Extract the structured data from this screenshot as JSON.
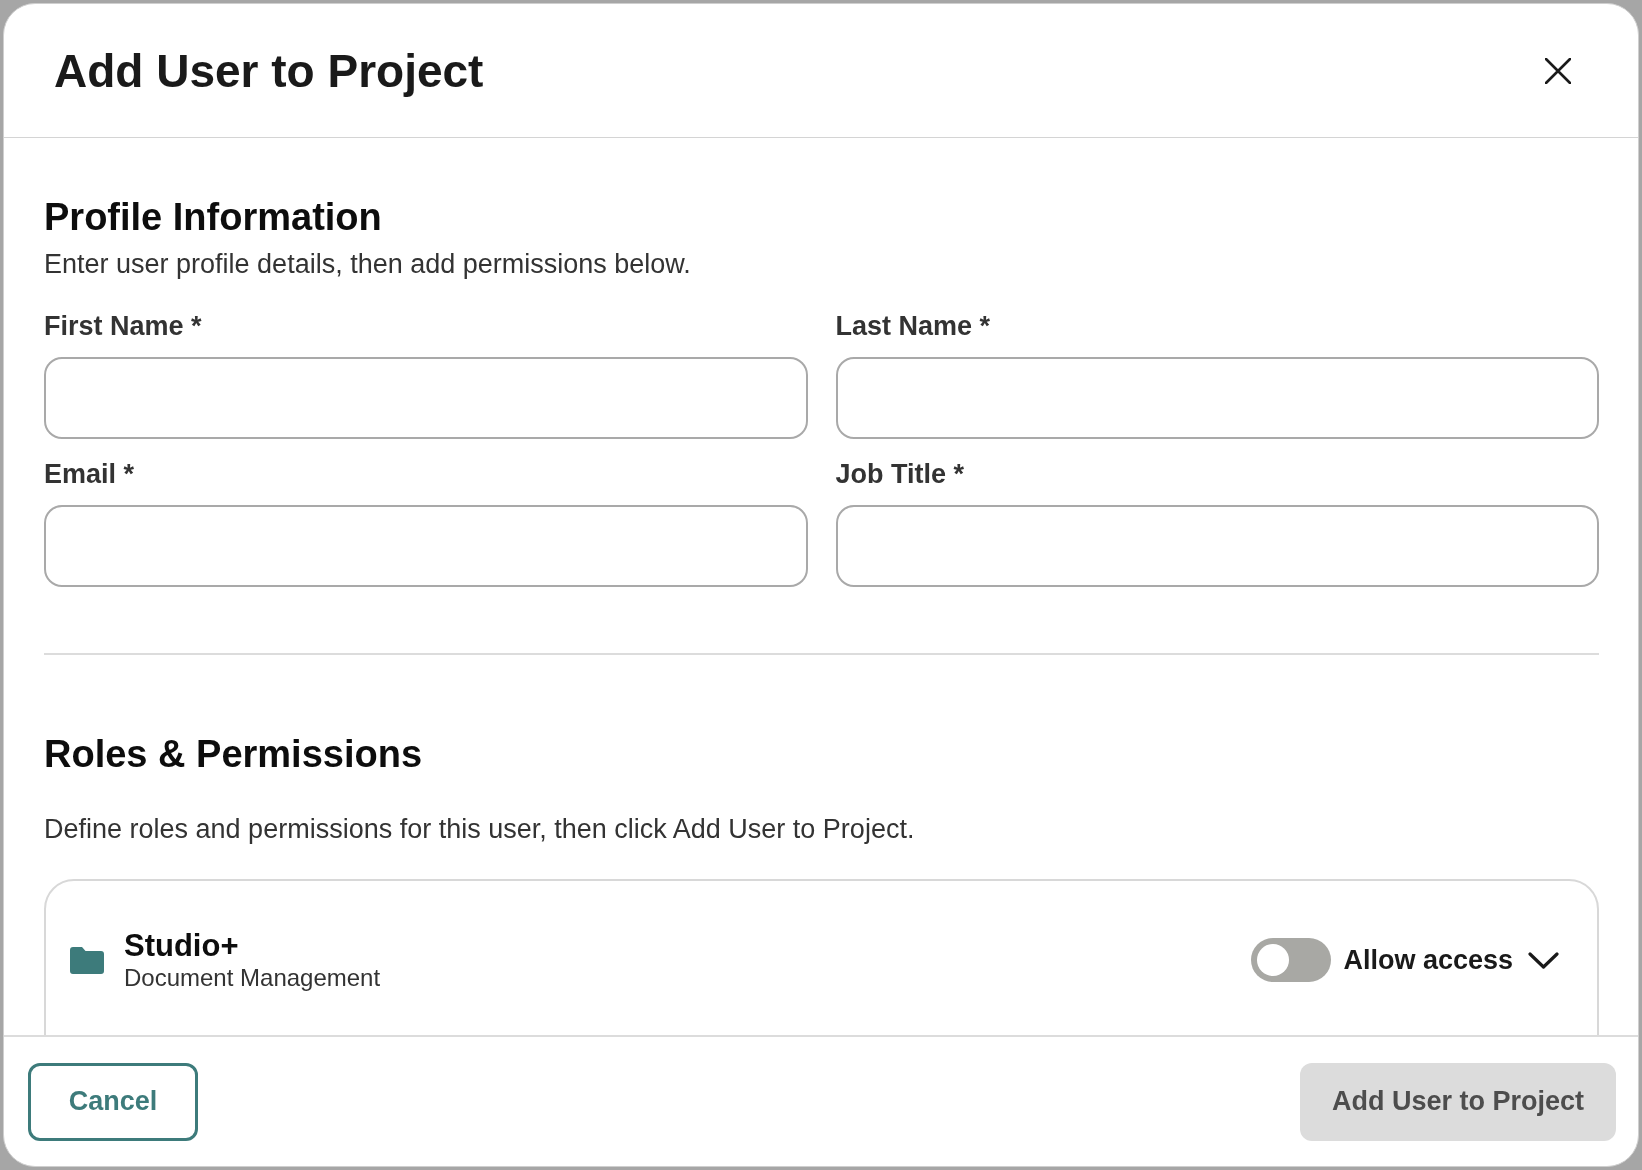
{
  "dialog": {
    "title": "Add User to Project"
  },
  "profile": {
    "heading": "Profile Information",
    "description": "Enter user profile details, then add permissions below.",
    "fields": [
      {
        "label": "First Name *"
      },
      {
        "label": "Last Name *"
      },
      {
        "label": "Email *"
      },
      {
        "label": "Job Title *"
      }
    ]
  },
  "permissions": {
    "heading": "Roles & Permissions",
    "description": "Define roles and permissions for this user, then click Add User to Project.",
    "apps": [
      {
        "name": "Studio+",
        "subtitle": "Document Management",
        "access_label": "Allow access",
        "on": false,
        "expanded": false
      }
    ]
  },
  "footer": {
    "buttons": [
      {
        "label": "Cancel",
        "kind": "secondary",
        "disabled": false
      },
      {
        "label": "Add User to Project",
        "kind": "primary",
        "disabled": true
      }
    ]
  }
}
